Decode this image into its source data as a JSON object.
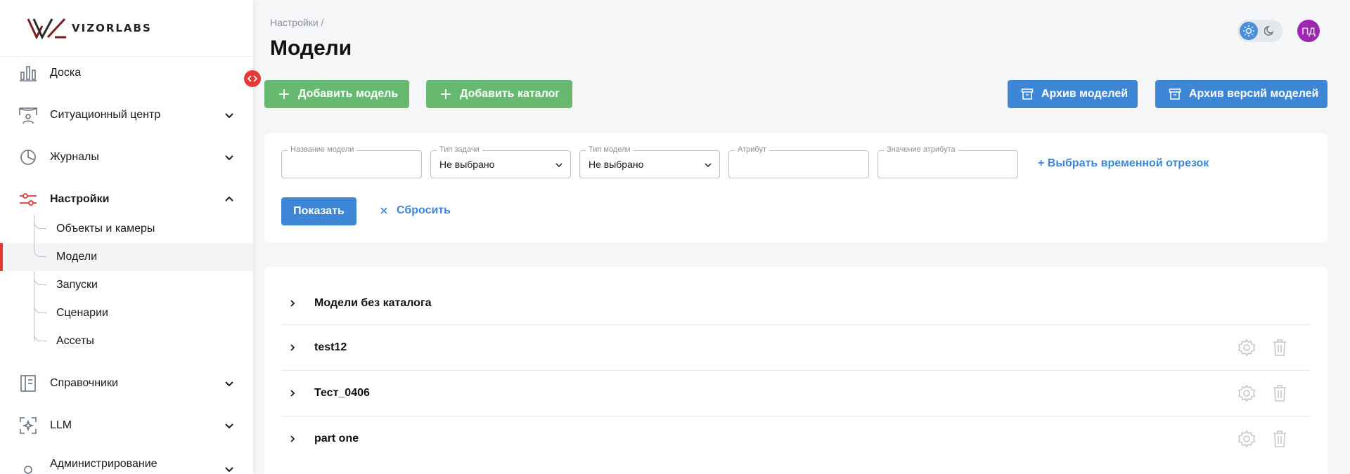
{
  "brand": {
    "logo_text": "VIZORLABS"
  },
  "sidebar": {
    "items": [
      {
        "label": "Доска",
        "icon": "bar-chart-icon"
      },
      {
        "label": "Ситуационный центр",
        "icon": "monitor-icon"
      },
      {
        "label": "Журналы",
        "icon": "pie-chart-icon"
      },
      {
        "label": "Настройки",
        "icon": "sliders-icon"
      },
      {
        "label": "Справочники",
        "icon": "book-icon"
      },
      {
        "label": "LLM",
        "icon": "sparkle-icon"
      },
      {
        "label": "Администрирование",
        "icon": "user-icon"
      }
    ],
    "settings_subitems": [
      {
        "label": "Объекты и камеры"
      },
      {
        "label": "Модели"
      },
      {
        "label": "Запуски"
      },
      {
        "label": "Сценарии"
      },
      {
        "label": "Ассеты"
      }
    ]
  },
  "header": {
    "breadcrumb": "Настройки /",
    "title": "Модели",
    "avatar_initials": "ПД"
  },
  "toolbar": {
    "add_model": "Добавить модель",
    "add_catalog": "Добавить каталог",
    "models_archive": "Архив моделей",
    "versions_archive": "Архив версий моделей"
  },
  "filters": {
    "model_name": {
      "label": "Название модели",
      "value": ""
    },
    "task_type": {
      "label": "Тип задачи",
      "value": "Не выбрано"
    },
    "model_type": {
      "label": "Тип модели",
      "value": "Не выбрано"
    },
    "attribute": {
      "label": "Атрибут",
      "value": ""
    },
    "attribute_value": {
      "label": "Значение атрибута",
      "value": ""
    },
    "time_range_link": "+ Выбрать временной отрезок",
    "show_label": "Показать",
    "reset_label": "Сбросить"
  },
  "catalogs": [
    {
      "label": "Модели без каталога"
    },
    {
      "label": "test12"
    },
    {
      "label": "Тест_0406"
    },
    {
      "label": "part one"
    }
  ],
  "colors": {
    "accent_red": "#e53935",
    "primary_blue": "#3d86d6",
    "success_green": "#66b96e",
    "avatar_purple": "#9c27b0"
  }
}
